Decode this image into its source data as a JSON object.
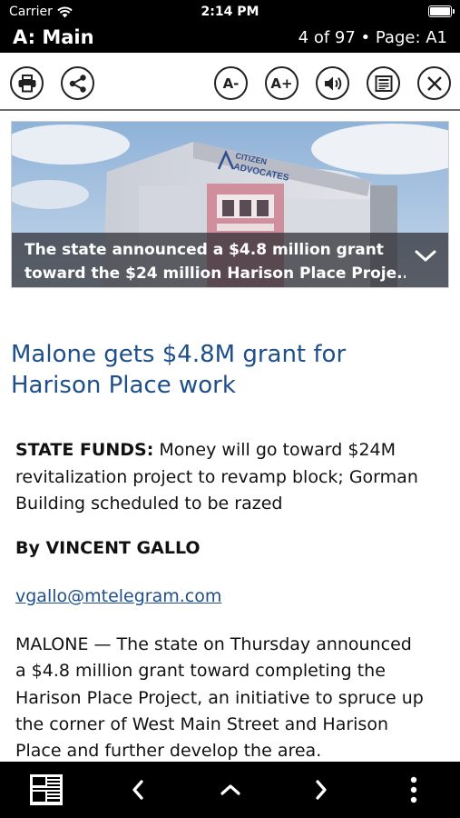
{
  "status_bar": {
    "carrier": "Carrier",
    "time": "2:14 PM"
  },
  "title_bar": {
    "section": "A: Main",
    "position": "4 of 97 • Page: A1"
  },
  "toolbar": {
    "print_icon": "printer-icon",
    "share_icon": "share-icon",
    "font_decrease": "A-",
    "font_increase": "A+",
    "audio_icon": "speaker-icon",
    "text_view_icon": "text-view-icon",
    "close_icon": "close-icon"
  },
  "image": {
    "sign_line1": "CITIZEN",
    "sign_line2": "ADVOCATES",
    "caption_line1": "The state announced a $4.8 million grant",
    "caption_line2": "toward the $24 million Harison Place Proje..."
  },
  "article": {
    "headline_line1": "Malone gets $4.8M grant for",
    "headline_line2": "Harison Place work",
    "deck_label": "STATE FUNDS:",
    "deck_line1": " Money will go toward $24M",
    "deck_line2": "revitalization project to revamp block; Gorman",
    "deck_line3": "Building scheduled to be razed",
    "byline": "By VINCENT GALLO",
    "email": "vgallo@mtelegram.com",
    "body_line1": "MALONE — The state on Thursday announced",
    "body_line2": "a $4.8 million grant toward completing the",
    "body_line3": "Harison Place Project, an initiative to spruce up",
    "body_line4": "the corner of West Main Street and Harison",
    "body_line5": "Place and further develop the area."
  },
  "bottom_bar": {
    "pages_icon": "newspaper-pages-icon",
    "prev_icon": "chevron-left-icon",
    "up_icon": "chevron-up-icon",
    "next_icon": "chevron-right-icon",
    "more_icon": "more-vertical-icon"
  },
  "colors": {
    "headline": "#1e4f8a",
    "bars": "#000000",
    "link": "#1e4f8a"
  }
}
